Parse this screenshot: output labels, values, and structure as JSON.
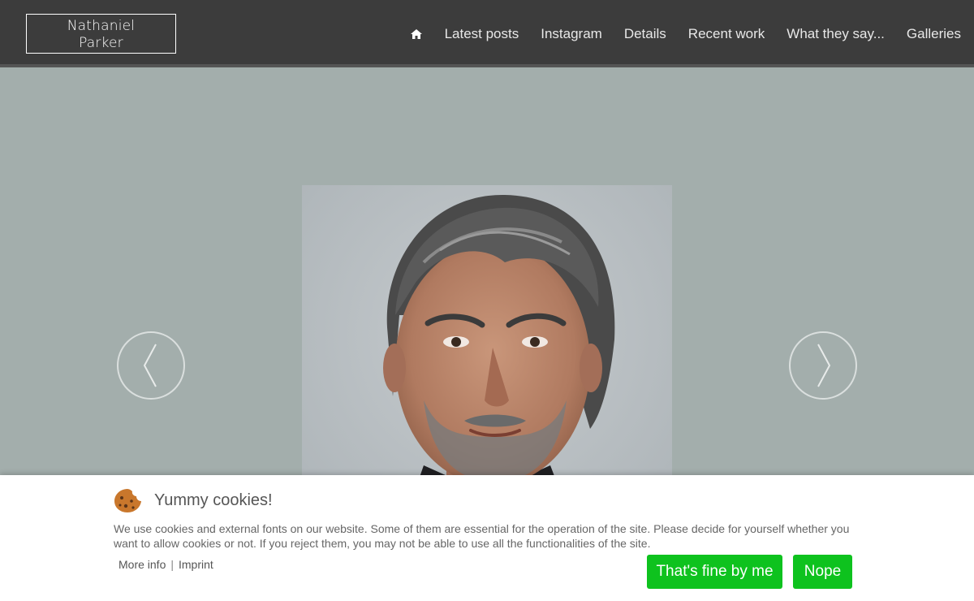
{
  "header": {
    "logo_line1": "Nathaniel",
    "logo_line2": "Parker",
    "nav": [
      {
        "icon": "home-icon"
      },
      {
        "label": "Latest posts"
      },
      {
        "label": "Instagram"
      },
      {
        "label": "Details"
      },
      {
        "label": "Recent work"
      },
      {
        "label": "What they say..."
      },
      {
        "label": "Galleries"
      }
    ]
  },
  "hero": {
    "prev_icon": "chevron-left-icon",
    "next_icon": "chevron-right-icon",
    "image": "portrait-photo"
  },
  "cookie": {
    "title": "Yummy cookies!",
    "text": "We use cookies and external fonts on our website. Some of them are essential for the operation of the site. Please decide for yourself whether you want to allow cookies or not. If you reject them, you may not be able to use all the functionalities of the site.",
    "more_info": "More info",
    "separator": "|",
    "imprint": "Imprint",
    "accept_label": "That's fine by me",
    "reject_label": "Nope"
  },
  "colors": {
    "topbar": "#3c3c3c",
    "hero_bg": "#a3aeac",
    "button": "#0ec21e"
  }
}
